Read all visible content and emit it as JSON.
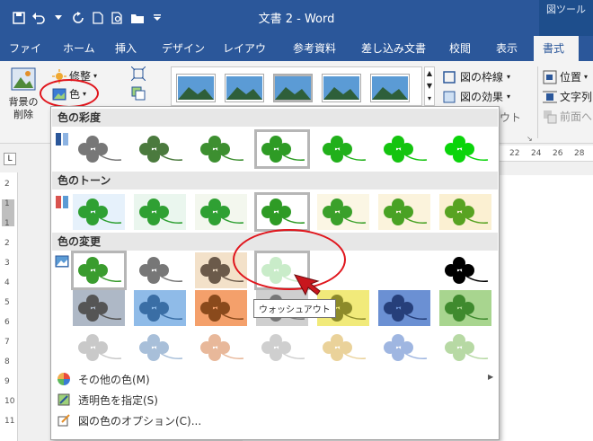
{
  "titlebar": {
    "doc_title": "文書 2 - Word",
    "context_label": "図ツール"
  },
  "tabs": [
    "ファイル",
    "ホーム",
    "挿入",
    "デザイン",
    "レイアウト",
    "参考資料",
    "差し込み文書",
    "校閲",
    "表示",
    "書式"
  ],
  "ribbon": {
    "remove_bg": "背景の削除",
    "corrections": "修整",
    "color": "色",
    "border": "図の枠線",
    "effects": "図の効果",
    "position": "位置",
    "wrap": "文字列",
    "bring_forward": "前面へ",
    "layout_fragment": "ウト"
  },
  "ruler": {
    "h_ticks": [
      "22",
      "24",
      "26",
      "28"
    ],
    "v_ticks": [
      "2",
      "1",
      "1",
      "2",
      "3",
      "4",
      "5",
      "6",
      "7",
      "8",
      "9",
      "10",
      "11"
    ]
  },
  "panel": {
    "sec_saturation": "色の彩度",
    "sec_tone": "色のトーン",
    "sec_recolor": "色の変更",
    "tooltip": "ウォッシュアウト",
    "menu_more": "その他の色(M)",
    "menu_transparent": "透明色を指定(S)",
    "menu_options": "図の色のオプション(C)..."
  },
  "colors": {
    "accent": "#2b579a",
    "highlight": "#e0151c"
  }
}
